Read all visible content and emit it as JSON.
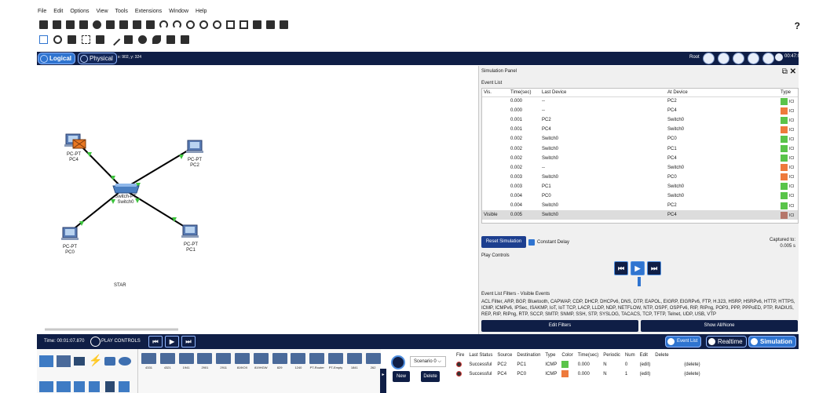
{
  "menu": [
    "File",
    "Edit",
    "Options",
    "View",
    "Tools",
    "Extensions",
    "Window",
    "Help"
  ],
  "help_mark": "?",
  "nav": {
    "logical": "Logical",
    "physical": "Physical",
    "coords": "x: 902, y: 324",
    "root": "Root",
    "clock": "00:47:00"
  },
  "canvas": {
    "devices": [
      {
        "type": "PC-PT",
        "name": "PC4"
      },
      {
        "type": "PC-PT",
        "name": "PC2"
      },
      {
        "type": "Switch-PT",
        "name": "Switch0"
      },
      {
        "type": "PC-PT",
        "name": "PC0"
      },
      {
        "type": "PC-PT",
        "name": "PC1"
      }
    ],
    "note": "STAR"
  },
  "sim": {
    "title": "Simulation Panel",
    "event_list_title": "Event List",
    "headers": [
      "Vis.",
      "Time(sec)",
      "Last Device",
      "At Device",
      "Type"
    ],
    "events": [
      {
        "vis": "",
        "time": "0.000",
        "last": "--",
        "at": "PC2",
        "color": "#5ac44a",
        "type": "ICI"
      },
      {
        "vis": "",
        "time": "0.000",
        "last": "--",
        "at": "PC4",
        "color": "#ee7a3c",
        "type": "ICI"
      },
      {
        "vis": "",
        "time": "0.001",
        "last": "PC2",
        "at": "Switch0",
        "color": "#5ac44a",
        "type": "ICI"
      },
      {
        "vis": "",
        "time": "0.001",
        "last": "PC4",
        "at": "Switch0",
        "color": "#ee7a3c",
        "type": "ICI"
      },
      {
        "vis": "",
        "time": "0.002",
        "last": "Switch0",
        "at": "PC0",
        "color": "#5ac44a",
        "type": "ICI"
      },
      {
        "vis": "",
        "time": "0.002",
        "last": "Switch0",
        "at": "PC1",
        "color": "#5ac44a",
        "type": "ICI"
      },
      {
        "vis": "",
        "time": "0.002",
        "last": "Switch0",
        "at": "PC4",
        "color": "#5ac44a",
        "type": "ICI"
      },
      {
        "vis": "",
        "time": "0.002",
        "last": "--",
        "at": "Switch0",
        "color": "#ee7a3c",
        "type": "ICI"
      },
      {
        "vis": "",
        "time": "0.003",
        "last": "Switch0",
        "at": "PC0",
        "color": "#ee7a3c",
        "type": "ICI"
      },
      {
        "vis": "",
        "time": "0.003",
        "last": "PC1",
        "at": "Switch0",
        "color": "#5ac44a",
        "type": "ICI"
      },
      {
        "vis": "",
        "time": "0.004",
        "last": "PC0",
        "at": "Switch0",
        "color": "#5ac44a",
        "type": "ICI"
      },
      {
        "vis": "",
        "time": "0.004",
        "last": "Switch0",
        "at": "PC2",
        "color": "#5ac44a",
        "type": "ICI"
      },
      {
        "vis": "Visible",
        "time": "0.005",
        "last": "Switch0",
        "at": "PC4",
        "color": "#b5766a",
        "type": "ICI"
      }
    ],
    "reset": "Reset Simulation",
    "constant_delay": "Constant Delay",
    "captured_label": "Captured to:",
    "captured_value": "0.005 s",
    "play_controls": "Play Controls",
    "filters_title": "Event List Filters - Visible Events",
    "filters_text": "ACL Filter, ARP, BGP, Bluetooth, CAPWAP, CDP, DHCP, DHCPv6, DNS, DTP, EAPOL, EIGRP, EIGRPv6, FTP, H.323, HSRP, HSRPv6, HTTP, HTTPS, ICMP, ICMPv6, IPSec, ISAKMP, IoT, IoT TCP, LACP, LLDP, NDP, NETFLOW, NTP, OSPF, OSPFv6, RIP, RIPng, POP3, PPP, PPPoED, PTP, RADIUS, REP, RIP, RIPng, RTP, SCCP, SMTP, SNMP, SSH, STP, SYSLOG, TACACS, TCP, TFTP, Telnet, UDP, USB, VTP",
    "edit_filters": "Edit Filters",
    "show_all": "Show All/None"
  },
  "bottom": {
    "time": "Time: 00:01:07.870",
    "play_controls": "PLAY CONTROLS",
    "event_list": "Event List",
    "realtime": "Realtime",
    "simulation": "Simulation"
  },
  "devices_row": [
    "4331",
    "4321",
    "1941",
    "2901",
    "2911",
    "819IOX",
    "819HGW",
    "829",
    "1240",
    "PT-Router",
    "PT-Empty",
    "1841",
    "262"
  ],
  "scenario": {
    "select": "Scenario 0",
    "new": "New",
    "delete": "Delete"
  },
  "pdu": {
    "headers": [
      "Fire",
      "Last Status",
      "Source",
      "Destination",
      "Type",
      "Color",
      "Time(sec)",
      "Periodic",
      "Num",
      "Edit",
      "Delete"
    ],
    "rows": [
      {
        "status": "Successful",
        "source": "PC2",
        "dest": "PC1",
        "type": "ICMP",
        "color": "#5ac44a",
        "time": "0.000",
        "periodic": "N",
        "num": "0",
        "edit": "(edit)",
        "delete": "(delete)"
      },
      {
        "status": "Successful",
        "source": "PC4",
        "dest": "PC0",
        "type": "ICMP",
        "color": "#ee7a3c",
        "time": "0.000",
        "periodic": "N",
        "num": "1",
        "edit": "(edit)",
        "delete": "(delete)"
      }
    ]
  }
}
